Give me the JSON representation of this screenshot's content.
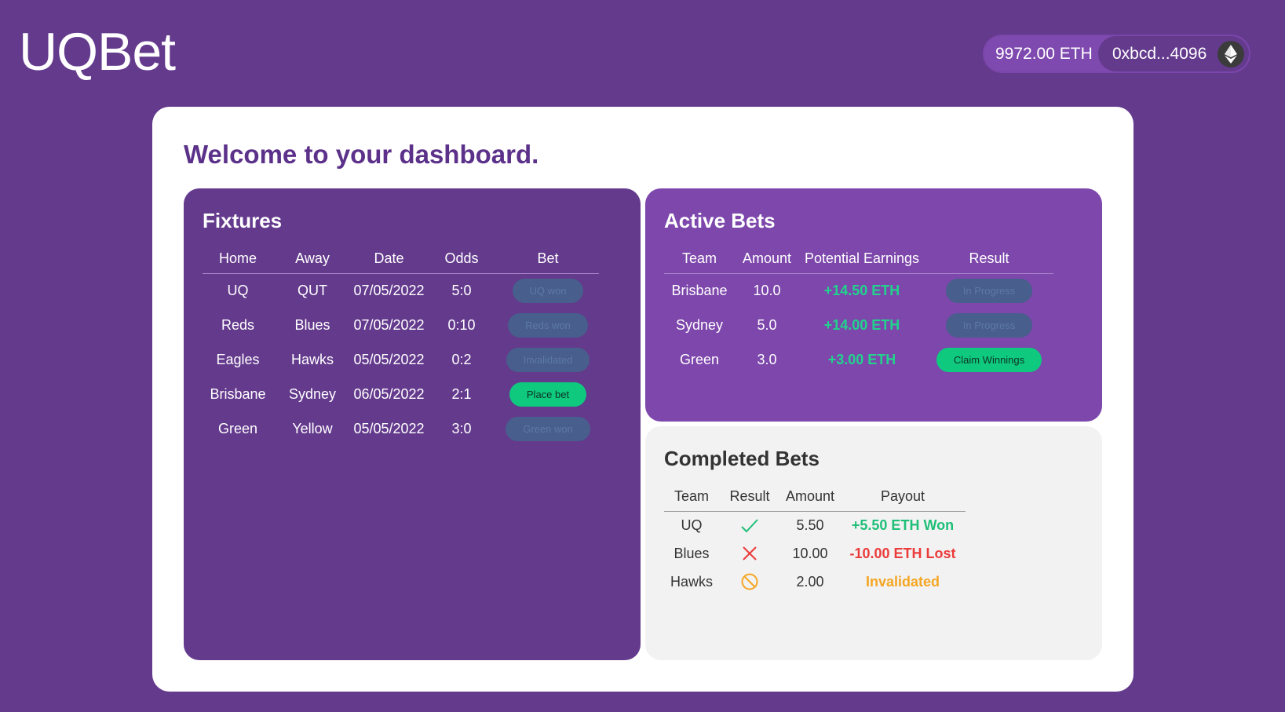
{
  "header": {
    "logo": "UQBet",
    "balance": "9972.00 ETH",
    "address": "0xbcd...4096"
  },
  "welcome": "Welcome to your dashboard.",
  "fixtures": {
    "title": "Fixtures",
    "columns": [
      "Home",
      "Away",
      "Date",
      "Odds",
      "Bet"
    ],
    "rows": [
      {
        "home": "UQ",
        "away": "QUT",
        "date": "07/05/2022",
        "odds": "5:0",
        "bet": "UQ won",
        "state": "disabled"
      },
      {
        "home": "Reds",
        "away": "Blues",
        "date": "07/05/2022",
        "odds": "0:10",
        "bet": "Reds won",
        "state": "disabled"
      },
      {
        "home": "Eagles",
        "away": "Hawks",
        "date": "05/05/2022",
        "odds": "0:2",
        "bet": "Invalidated",
        "state": "disabled"
      },
      {
        "home": "Brisbane",
        "away": "Sydney",
        "date": "06/05/2022",
        "odds": "2:1",
        "bet": "Place bet",
        "state": "active"
      },
      {
        "home": "Green",
        "away": "Yellow",
        "date": "05/05/2022",
        "odds": "3:0",
        "bet": "Green won",
        "state": "disabled"
      }
    ]
  },
  "active_bets": {
    "title": "Active Bets",
    "columns": [
      "Team",
      "Amount",
      "Potential Earnings",
      "Result"
    ],
    "rows": [
      {
        "team": "Brisbane",
        "amount": "10.0",
        "earnings": "+14.50 ETH",
        "result": "In Progress",
        "state": "disabled"
      },
      {
        "team": "Sydney",
        "amount": "5.0",
        "earnings": "+14.00 ETH",
        "result": "In Progress",
        "state": "disabled"
      },
      {
        "team": "Green",
        "amount": "3.0",
        "earnings": "+3.00 ETH",
        "result": "Claim Winnings",
        "state": "active"
      }
    ]
  },
  "completed_bets": {
    "title": "Completed Bets",
    "columns": [
      "Team",
      "Result",
      "Amount",
      "Payout"
    ],
    "rows": [
      {
        "team": "UQ",
        "result_icon": "check-icon",
        "amount": "5.50",
        "payout": "+5.50 ETH Won",
        "status": "won"
      },
      {
        "team": "Blues",
        "result_icon": "cross-icon",
        "amount": "10.00",
        "payout": "-10.00 ETH Lost",
        "status": "lost"
      },
      {
        "team": "Hawks",
        "result_icon": "prohibited-icon",
        "amount": "2.00",
        "payout": "Invalidated",
        "status": "invalidated"
      }
    ]
  },
  "colors": {
    "background": "#643a8d",
    "accent_green": "#0ec97e",
    "won": "#1fbf78",
    "lost": "#ec3b3b",
    "invalidated": "#f5a623"
  }
}
